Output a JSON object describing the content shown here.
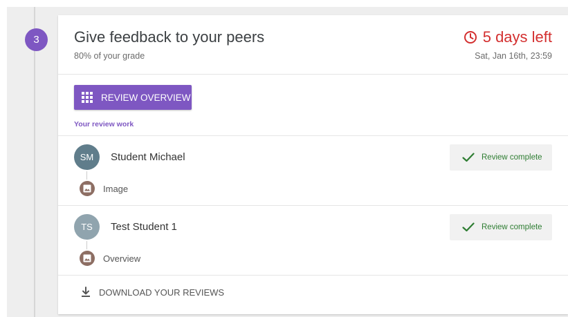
{
  "step": {
    "number": "3"
  },
  "header": {
    "title": "Give feedback to your peers",
    "subtitle": "80% of your grade",
    "deadline": "5 days left",
    "deadline_date": "Sat, Jan 16th, 23:59"
  },
  "review_overview_button": {
    "label": "REVIEW OVERVIEW",
    "icon": "grid-icon"
  },
  "section_label": "Your review work",
  "reviews": [
    {
      "initials": "SM",
      "name": "Student Michael",
      "avatar_color": "#607d8b",
      "submission_label": "Image",
      "submission_icon": "image-icon",
      "status": "Review complete",
      "status_icon": "check-icon"
    },
    {
      "initials": "TS",
      "name": "Test Student 1",
      "avatar_color": "#90a4ae",
      "submission_label": "Overview",
      "submission_icon": "image-icon",
      "status": "Review complete",
      "status_icon": "check-icon"
    }
  ],
  "download": {
    "label": "DOWNLOAD YOUR REVIEWS",
    "icon": "download-icon"
  },
  "colors": {
    "accent": "#7e57c2",
    "deadline": "#d32f2f",
    "success": "#2e7d32"
  }
}
